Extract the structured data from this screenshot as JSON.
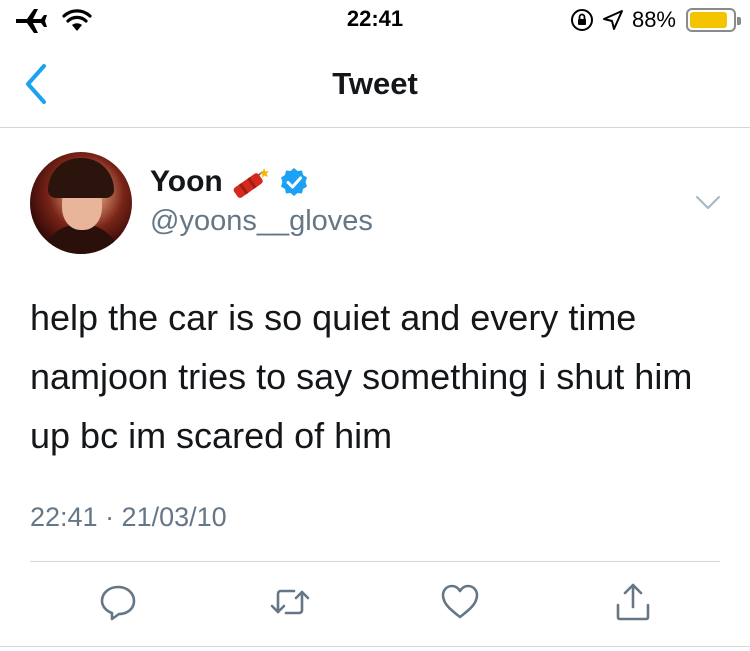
{
  "status_bar": {
    "time": "22:41",
    "battery_percent": "88%",
    "battery_level": 0.88,
    "icons": [
      "airplane-icon",
      "wifi-icon",
      "orientation-lock-icon",
      "location-icon",
      "battery-icon"
    ]
  },
  "nav": {
    "title": "Tweet",
    "back_icon": "chevron-left-icon"
  },
  "tweet": {
    "display_name": "Yoon",
    "username": "@yoons__gloves",
    "text": "help the car is so quiet and every time namjoon tries to say something i shut him up bc im scared of him",
    "timestamp": "22:41 · 21/03/10",
    "badges": [
      "dynamite-emoji",
      "verified-badge-icon"
    ]
  },
  "actions": {
    "icons": [
      "reply-icon",
      "retweet-icon",
      "like-icon",
      "share-icon"
    ]
  },
  "colors": {
    "accent": "#1da1f2",
    "secondary_text": "#657786",
    "battery_yellow": "#f5c400"
  }
}
